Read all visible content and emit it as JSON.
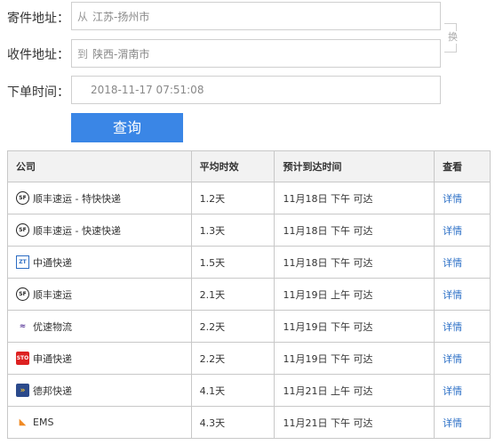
{
  "form": {
    "sender_label": "寄件地址：",
    "sender_prefix": "从",
    "sender_value": "江苏-扬州市",
    "receiver_label": "收件地址：",
    "receiver_prefix": "到",
    "receiver_value": "陕西-渭南市",
    "swap_label": "换",
    "time_label": "下单时间：",
    "time_value": "2018-11-17 07:51:08",
    "query_button": "查询"
  },
  "table": {
    "headers": [
      "公司",
      "平均时效",
      "预计到达时间",
      "查看"
    ],
    "rows": [
      {
        "logo": "sf-logo-icon",
        "logo_text": "SF",
        "company": "顺丰速运 - 特快快递",
        "avg": "1.2天",
        "eta": "11月18日 下午 可达",
        "action": "详情"
      },
      {
        "logo": "sf-logo-icon",
        "logo_text": "SF",
        "company": "顺丰速运 - 快速快递",
        "avg": "1.3天",
        "eta": "11月18日 下午 可达",
        "action": "详情"
      },
      {
        "logo": "zto-logo-icon",
        "logo_text": "ZT",
        "company": "中通快递",
        "avg": "1.5天",
        "eta": "11月18日 下午 可达",
        "action": "详情"
      },
      {
        "logo": "sf-logo-icon",
        "logo_text": "SF",
        "company": "顺丰速运",
        "avg": "2.1天",
        "eta": "11月19日 上午 可达",
        "action": "详情"
      },
      {
        "logo": "yunda-logo-icon",
        "logo_text": "≈",
        "company": "优速物流",
        "avg": "2.2天",
        "eta": "11月19日 下午 可达",
        "action": "详情"
      },
      {
        "logo": "sto-logo-icon",
        "logo_text": "STO",
        "company": "申通快递",
        "avg": "2.2天",
        "eta": "11月19日 下午 可达",
        "action": "详情"
      },
      {
        "logo": "deppon-logo-icon",
        "logo_text": "»",
        "company": "德邦快递",
        "avg": "4.1天",
        "eta": "11月21日 上午 可达",
        "action": "详情"
      },
      {
        "logo": "ems-logo-icon",
        "logo_text": "◣",
        "company": "EMS",
        "avg": "4.3天",
        "eta": "11月21日 下午 可达",
        "action": "详情"
      }
    ]
  }
}
